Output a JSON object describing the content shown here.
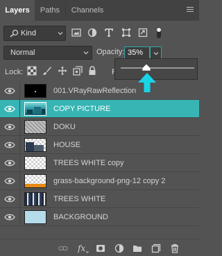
{
  "tabs": [
    {
      "label": "Layers",
      "active": true
    },
    {
      "label": "Paths",
      "active": false
    },
    {
      "label": "Channels",
      "active": false
    }
  ],
  "filter": {
    "kind_label": "Kind",
    "icons": [
      "image-filter-icon",
      "adjustment-filter-icon",
      "type-filter-icon",
      "shape-filter-icon",
      "smart-object-filter-icon",
      "filter-toggle-icon"
    ]
  },
  "blend": {
    "mode": "Normal",
    "opacity_label": "Opacity:",
    "opacity_value": "35%",
    "opacity_fraction": 0.35
  },
  "lock": {
    "label": "Lock:",
    "fill_label": "F",
    "icons": [
      "lock-transparent-pixels-icon",
      "lock-image-pixels-icon",
      "lock-position-icon",
      "prevent-autonest-icon",
      "lock-all-icon"
    ]
  },
  "layers": [
    {
      "name": "001.VRayRawReflection",
      "visible": true,
      "selected": false,
      "thumb": "black"
    },
    {
      "name": "COPY PICTURE",
      "visible": true,
      "selected": true,
      "thumb": "teal-city"
    },
    {
      "name": "DOKU",
      "visible": true,
      "selected": false,
      "thumb": "noise"
    },
    {
      "name": "HOUSE",
      "visible": true,
      "selected": false,
      "thumb": "house"
    },
    {
      "name": "TREES WHITE copy",
      "visible": true,
      "selected": false,
      "thumb": "checker"
    },
    {
      "name": "grass-background-png-12 copy 2",
      "visible": true,
      "selected": false,
      "thumb": "grass"
    },
    {
      "name": "TREES WHITE",
      "visible": true,
      "selected": false,
      "thumb": "trees"
    },
    {
      "name": "BACKGROUND",
      "visible": true,
      "selected": false,
      "thumb": "sky"
    }
  ],
  "bottom_icons": [
    "link-layers-icon",
    "fx-icon",
    "add-mask-icon",
    "adjustment-layer-icon",
    "new-group-icon",
    "new-layer-icon",
    "delete-layer-icon"
  ],
  "colors": {
    "accent": "#37b5b5",
    "panel": "#535353",
    "arrow": "#19d3e6"
  }
}
